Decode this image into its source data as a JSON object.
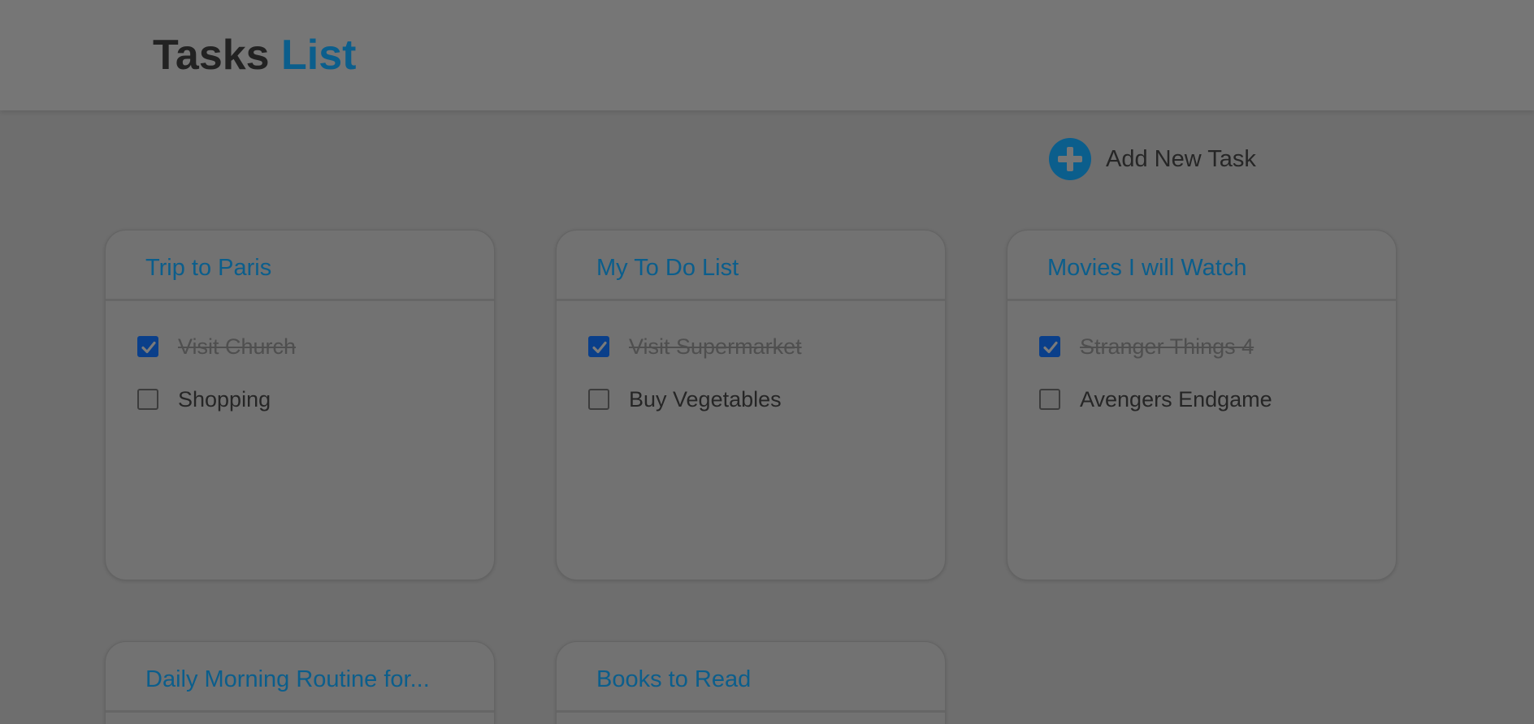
{
  "header": {
    "title_part1": "Tasks",
    "title_part2": "List"
  },
  "add_task": {
    "label": "Add New Task",
    "icon": "plus-circle-icon"
  },
  "colors": {
    "accent": "#0b5e8c",
    "checkbox_checked": "#0a3f8a",
    "overlay_background": "#6e6e6e"
  },
  "lists": [
    {
      "title": "Trip to Paris",
      "tasks": [
        {
          "label": "Visit Church",
          "done": true
        },
        {
          "label": "Shopping",
          "done": false
        }
      ]
    },
    {
      "title": "My To Do List",
      "tasks": [
        {
          "label": "Visit Supermarket",
          "done": true
        },
        {
          "label": "Buy Vegetables",
          "done": false
        }
      ]
    },
    {
      "title": "Movies I will Watch",
      "tasks": [
        {
          "label": "Stranger Things 4",
          "done": true
        },
        {
          "label": "Avengers Endgame",
          "done": false
        }
      ]
    },
    {
      "title": "Daily Morning Routine for...",
      "tasks": []
    },
    {
      "title": "Books to Read",
      "tasks": []
    }
  ]
}
